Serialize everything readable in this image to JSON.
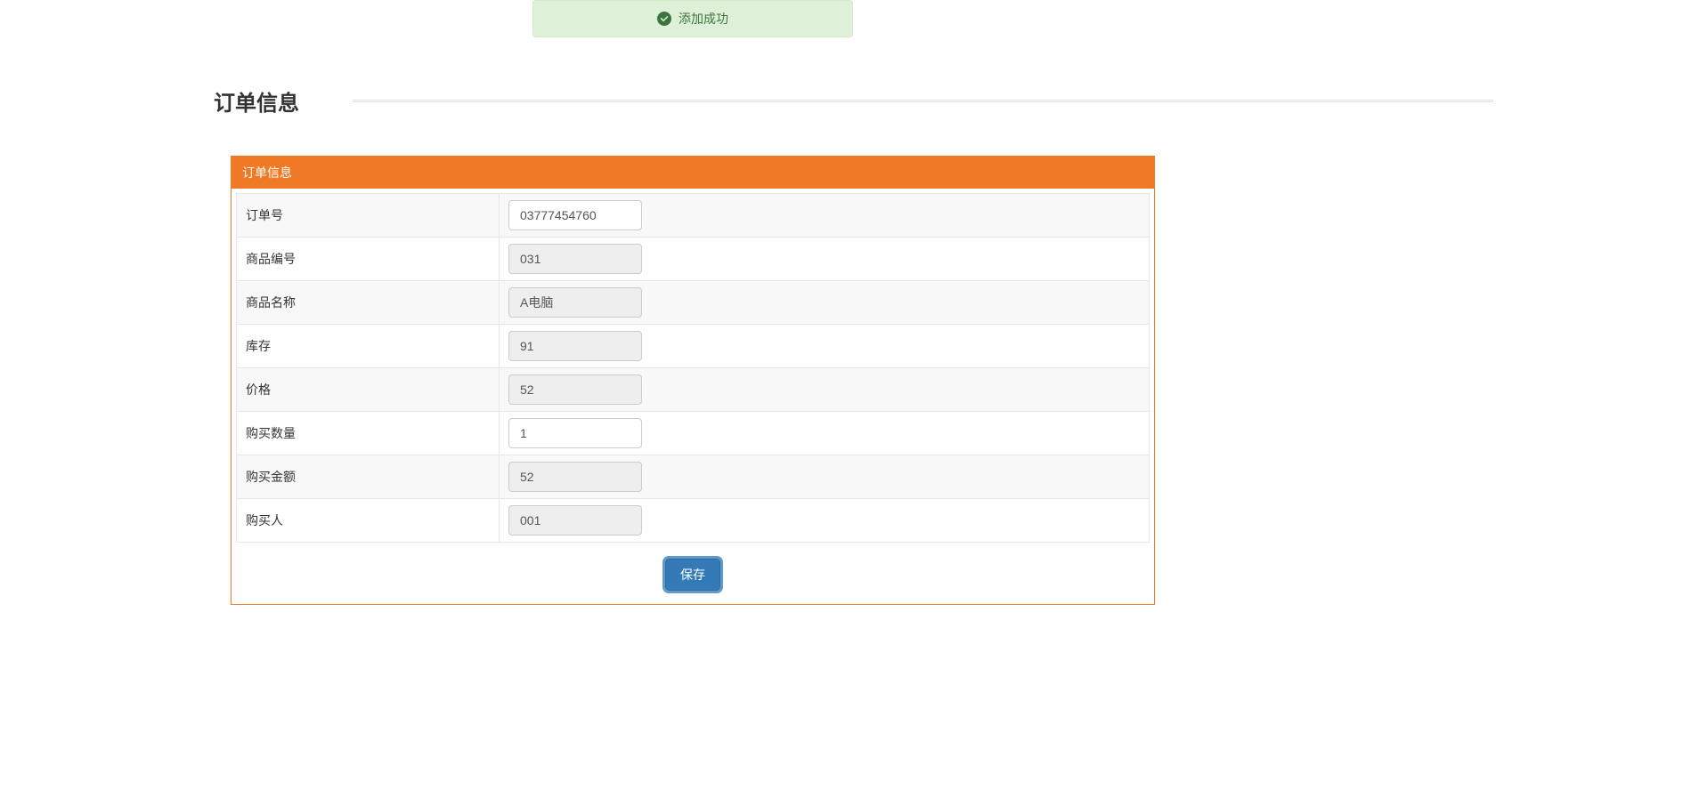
{
  "alert": {
    "text": "添加成功"
  },
  "page": {
    "title": "订单信息"
  },
  "panel": {
    "header": "订单信息"
  },
  "form": {
    "order_no": {
      "label": "订单号",
      "value": "03777454760"
    },
    "product_code": {
      "label": "商品编号",
      "value": "031"
    },
    "product_name": {
      "label": "商品名称",
      "value": "A电脑"
    },
    "stock": {
      "label": "库存",
      "value": "91"
    },
    "price": {
      "label": "价格",
      "value": "52"
    },
    "qty": {
      "label": "购买数量",
      "value": "1"
    },
    "amount": {
      "label": "购买金额",
      "value": "52"
    },
    "buyer": {
      "label": "购买人",
      "value": "001"
    }
  },
  "buttons": {
    "save": "保存"
  }
}
